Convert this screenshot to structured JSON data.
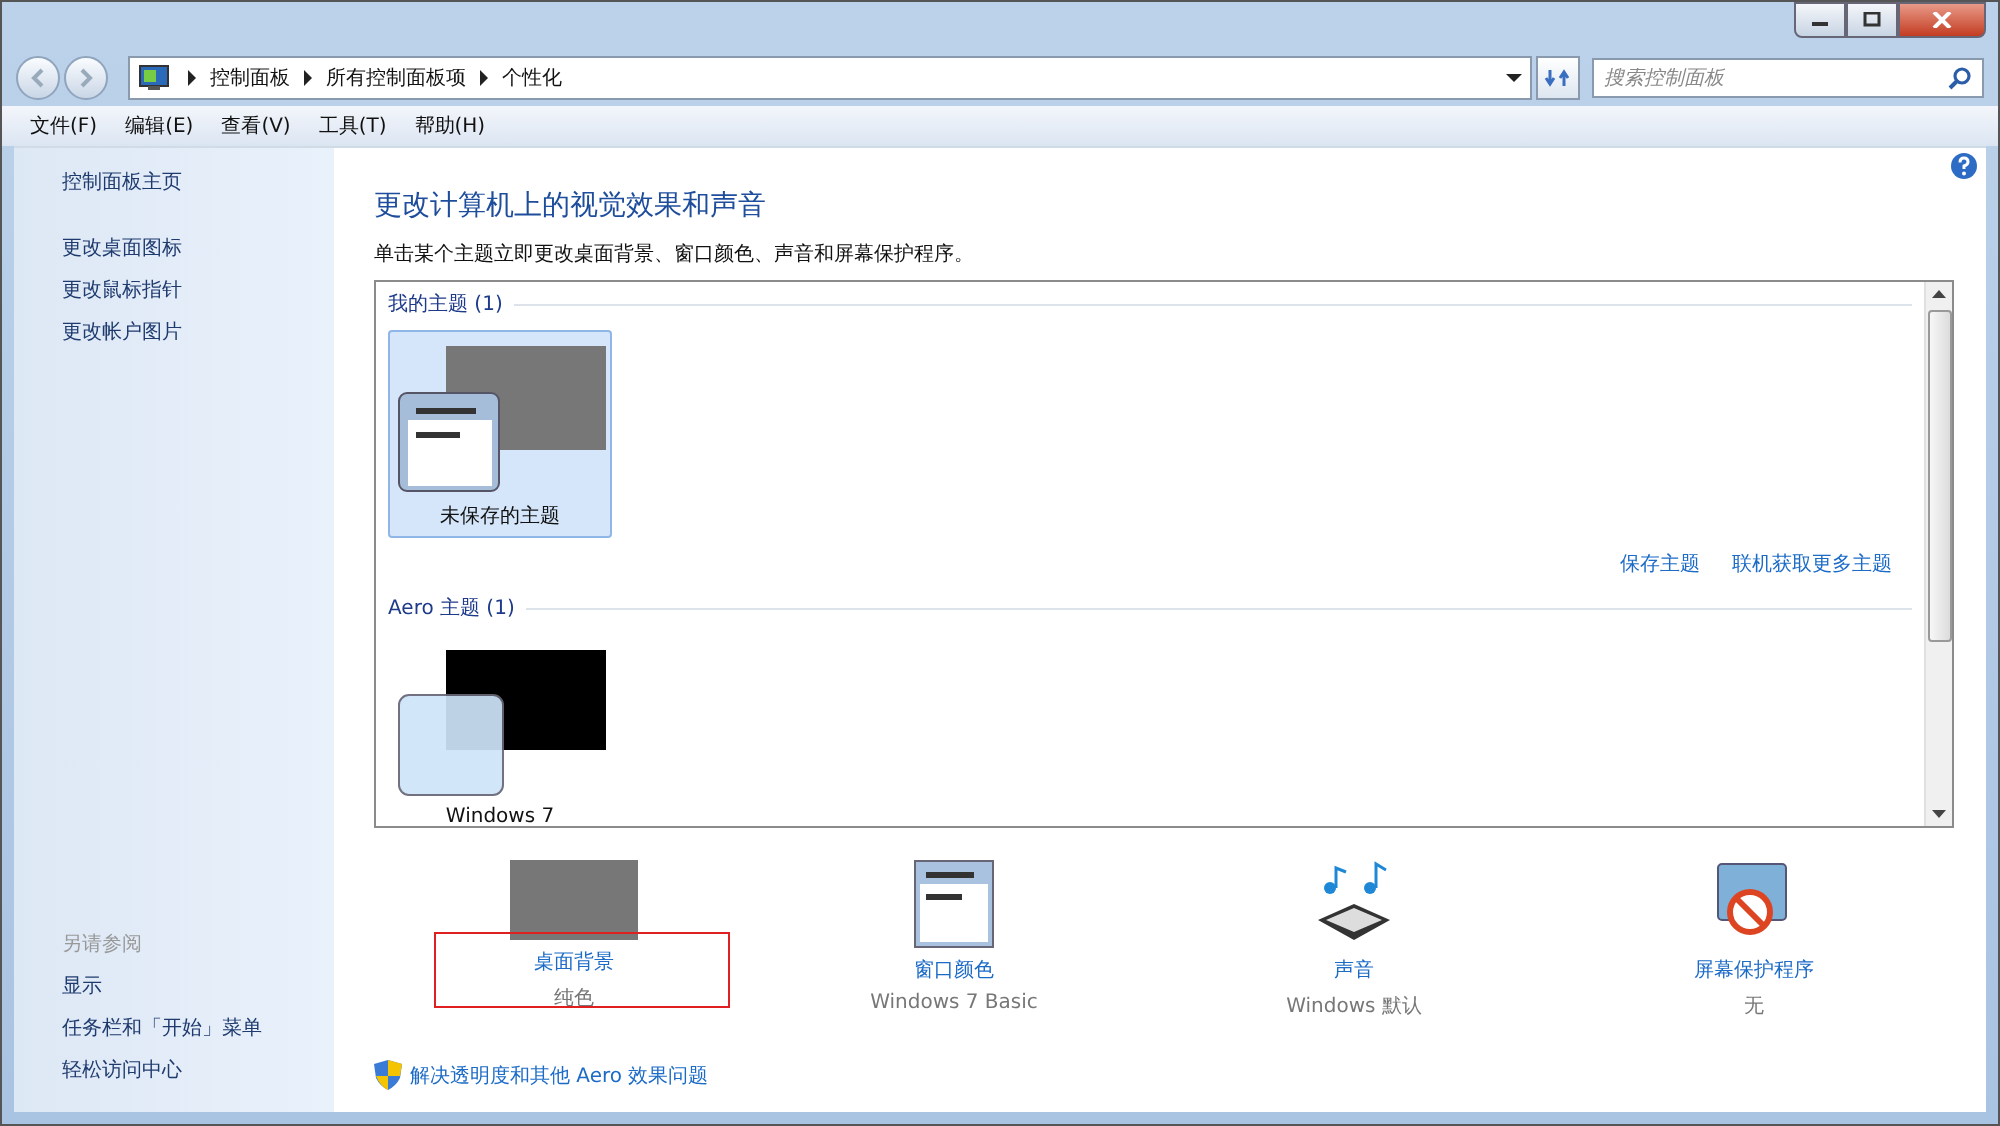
{
  "address_bar": {
    "path": [
      "控制面板",
      "所有控制面板项",
      "个性化"
    ]
  },
  "search": {
    "placeholder": "搜索控制面板"
  },
  "menu": [
    "文件(F)",
    "编辑(E)",
    "查看(V)",
    "工具(T)",
    "帮助(H)"
  ],
  "sidebar": {
    "links": [
      "控制面板主页",
      "更改桌面图标",
      "更改鼠标指针",
      "更改帐户图片"
    ],
    "see_also_title": "另请参阅",
    "see_also": [
      "显示",
      "任务栏和「开始」菜单",
      "轻松访问中心"
    ]
  },
  "main": {
    "title": "更改计算机上的视觉效果和声音",
    "description": "单击某个主题立即更改桌面背景、窗口颜色、声音和屏幕保护程序。",
    "groups": [
      {
        "title": "我的主题 (1)",
        "themes": [
          {
            "name": "未保存的主题",
            "selected": true,
            "kind": "basic"
          }
        ],
        "links": [
          "保存主题",
          "联机获取更多主题"
        ]
      },
      {
        "title": "Aero 主题 (1)",
        "themes": [
          {
            "name": "Windows 7",
            "selected": false,
            "kind": "aero"
          }
        ]
      }
    ],
    "settings": [
      {
        "label": "桌面背景",
        "value": "纯色",
        "kind": "background"
      },
      {
        "label": "窗口颜色",
        "value": "Windows 7 Basic",
        "kind": "color"
      },
      {
        "label": "声音",
        "value": "Windows 默认",
        "kind": "sound"
      },
      {
        "label": "屏幕保护程序",
        "value": "无",
        "kind": "screensaver"
      }
    ],
    "aero_link": "解决透明度和其他 Aero 效果问题"
  }
}
